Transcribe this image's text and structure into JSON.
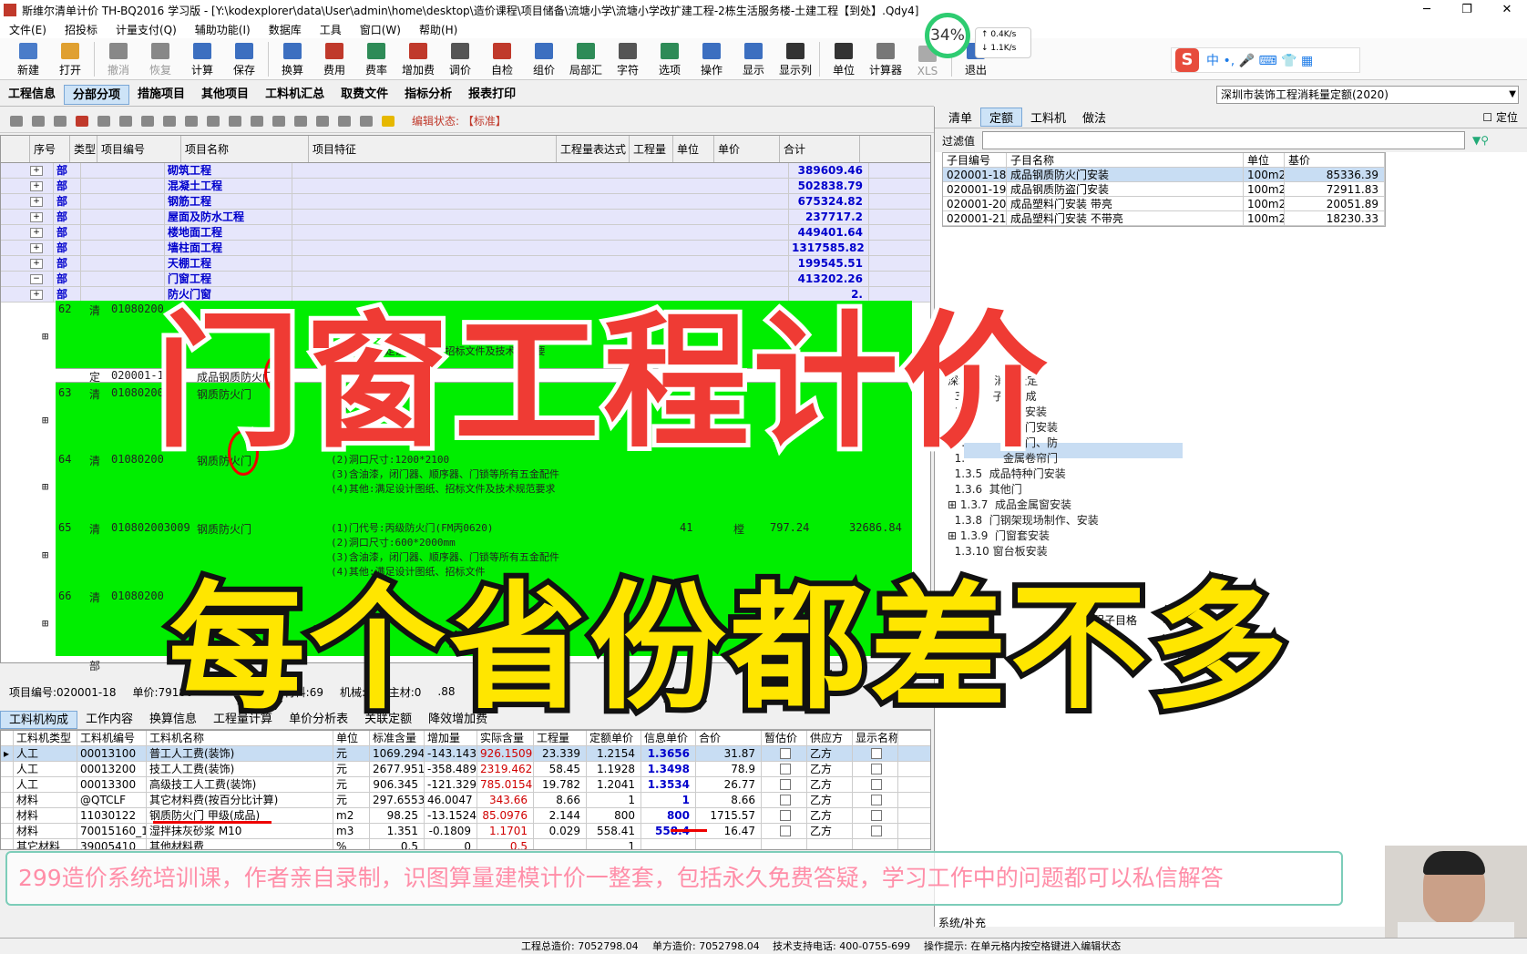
{
  "window": {
    "title": "斯维尔清单计价 TH-BQ2016 学习版 - [Y:\\kodexplorer\\data\\User\\admin\\home\\desktop\\造价课程\\项目储备\\流塘小学\\流塘小学改扩建工程-2栋生活服务楼-土建工程【到处】.Qdy4]",
    "minimize": "─",
    "maximize": "❐",
    "close": "✕"
  },
  "menu": [
    "文件(E)",
    "招投标",
    "计量支付(Q)",
    "辅助功能(I)",
    "数据库",
    "工具",
    "窗口(W)",
    "帮助(H)"
  ],
  "toolbar": [
    "新建",
    "打开",
    "撤消",
    "恢复",
    "计算",
    "保存",
    "换算",
    "费用",
    "费率",
    "增加费",
    "调价",
    "自检",
    "组价",
    "局部汇",
    "字符",
    "选项",
    "操作",
    "显示",
    "显示列",
    "单位",
    "计算器",
    "XLS",
    "退出"
  ],
  "gauge": {
    "percent": "34%",
    "up": "0.4K/s",
    "down": "1.1K/s"
  },
  "ime": {
    "logo": "S",
    "label": "中 •, 🎤 ⌨ 👕 ▦"
  },
  "navtabs": [
    "工程信息",
    "分部分项",
    "措施项目",
    "其他项目",
    "工料机汇总",
    "取费文件",
    "指标分析",
    "报表打印"
  ],
  "quota_select": "深圳市装饰工程消耗量定额(2020)",
  "edit_status": "编辑状态: 【标准】",
  "grid": {
    "columns": [
      "序号",
      "类型",
      "项目编号",
      "项目名称",
      "项目特征",
      "工程量表达式",
      "工程量",
      "单位",
      "单价",
      "合计"
    ],
    "sections": [
      {
        "type": "部",
        "name": "砌筑工程",
        "total": "389609.46"
      },
      {
        "type": "部",
        "name": "混凝土工程",
        "total": "502838.79"
      },
      {
        "type": "部",
        "name": "钢筋工程",
        "total": "675324.82"
      },
      {
        "type": "部",
        "name": "屋面及防水工程",
        "total": "237717.2"
      },
      {
        "type": "部",
        "name": "楼地面工程",
        "total": "449401.64"
      },
      {
        "type": "部",
        "name": "墙柱面工程",
        "total": "1317585.82"
      },
      {
        "type": "部",
        "name": "天棚工程",
        "total": "199545.51"
      },
      {
        "type": "部",
        "name": "门窗工程",
        "total": "413202.26"
      },
      {
        "type": "部",
        "name": "防火门窗",
        "total": "2."
      }
    ],
    "rows": [
      {
        "seq": "62",
        "type": "清",
        "code": "01080200",
        "spec": "(4)其他:满足设计图纸、招标文件及技术规范要"
      },
      {
        "seq": "",
        "type": "定",
        "code": "020001-18",
        "name": "成品钢质防火门安",
        "qty": "0.0"
      },
      {
        "seq": "63",
        "type": "清",
        "code": "01080200",
        "name": "钢质防火门",
        "spec": "(2)\n(3)\n(4)",
        "total": "5"
      },
      {
        "seq": "64",
        "type": "清",
        "code": "01080200",
        "name": "钢质防火门",
        "spec": "(2)洞口尺寸:1200*2100\n(3)含油漆，闭门器、顺序器、门锁等所有五金配件\n(4)其他:满足设计图纸、招标文件及技术规范要求"
      },
      {
        "seq": "65",
        "type": "清",
        "code": "010802003009",
        "name": "钢质防火门",
        "spec": "(1)门代号:丙级防火门(FM丙0620)\n(2)洞口尺寸:600*2000mm\n(3)含油漆，闭门器、顺序器、门锁等所有五金配件\n(4)其他:满足设计图纸、招标文件",
        "qty": "41",
        "unit": "樘",
        "price": "797.24",
        "total": "32686.84"
      },
      {
        "seq": "66",
        "type": "清",
        "code": "01080200"
      },
      {
        "seq": "",
        "type": "部"
      }
    ]
  },
  "right": {
    "tabs": [
      "清单",
      "定额",
      "工料机",
      "做法"
    ],
    "locate": "定位",
    "filter_label": "过滤值",
    "table_headers": [
      "子目编号",
      "子目名称",
      "单位",
      "基价"
    ],
    "table_rows": [
      [
        "020001-18",
        "成品钢质防火门安装",
        "100m2",
        "85336.39"
      ],
      [
        "020001-19",
        "成品钢质防盗门安装",
        "100m2",
        "72911.83"
      ],
      [
        "020001-20",
        "成品塑料门安装 带亮",
        "100m2",
        "20051.89"
      ],
      [
        "020001-21",
        "成品塑料门安装 不带亮",
        "100m2",
        "18230.33"
      ]
    ],
    "tree": [
      "深圳市    消耗量定",
      "  3         子目构成",
      "  1.           木门安装",
      "  1.           金属门安装",
      "  1.           防火门、防",
      "  1.           金属卷帘门",
      "  1.3.5  成品特种门安装",
      "  1.3.6  其他门",
      "⊞ 1.3.7  成品金属窗安装",
      "  1.3.8  门钢架现场制作、安装",
      "⊞ 1.3.9  门窗套安装",
      "  1.3.10 窗台板安装"
    ],
    "extra": "程子目格"
  },
  "info": {
    "code": "项目编号:020001-18",
    "price": "单价:79186",
    "material": "材料:69",
    "machine": "机械:0",
    "main": "主材:0",
    "other": ".88"
  },
  "btabs": [
    "工料机构成",
    "工作内容",
    "换算信息",
    "工程量计算",
    "单价分析表",
    "关联定额",
    "降效增加费"
  ],
  "btable": {
    "headers": [
      "工料机类型",
      "工料机编号",
      "工料机名称",
      "单位",
      "标准含量",
      "增加量",
      "实际含量",
      "工程量",
      "定额单价",
      "信息单价",
      "合价",
      "暂估价",
      "供应方",
      "显示名称"
    ],
    "rows": [
      [
        "人工",
        "00013100",
        "普工人工费(装饰)",
        "元",
        "1069.294",
        "-143.1431",
        "926.1509",
        "23.339",
        "1.2154",
        "1.3656",
        "31.87",
        "",
        "乙方",
        ""
      ],
      [
        "人工",
        "00013200",
        "技工人工费(装饰)",
        "元",
        "2677.951",
        "-358.489",
        "2319.462",
        "58.45",
        "1.1928",
        "1.3498",
        "78.9",
        "",
        "乙方",
        ""
      ],
      [
        "人工",
        "00013300",
        "高级技工人工费(装饰)",
        "元",
        "906.345",
        "-121.3296",
        "785.0154",
        "19.782",
        "1.2041",
        "1.3534",
        "26.77",
        "",
        "乙方",
        ""
      ],
      [
        "材料",
        "@QTCLF",
        "其它材料费(按百分比计算)",
        "元",
        "297.6553",
        "46.0047",
        "343.66",
        "8.66",
        "1",
        "1",
        "8.66",
        "",
        "乙方",
        ""
      ],
      [
        "材料",
        "11030122",
        "钢质防火门 甲级(成品)",
        "m2",
        "98.25",
        "-13.1524",
        "85.0976",
        "2.144",
        "800",
        "800",
        "1715.57",
        "",
        "乙方",
        ""
      ],
      [
        "材料",
        "70015160_1",
        "湿拌抹灰砂浆 M10",
        "m3",
        "1.351",
        "-0.1809",
        "1.1701",
        "0.029",
        "558.41",
        "558.4",
        "16.47",
        "",
        "乙方",
        ""
      ],
      [
        "其它材料",
        "39005410",
        "其他材料费",
        "%",
        "0.5",
        "0",
        "0.5",
        "",
        "1",
        "",
        "",
        "",
        "",
        ""
      ]
    ]
  },
  "banner": "299造价系统培训课，作者亲自录制，识图算量建模计价一整套，包括永久免费答疑，学习工作中的问题都可以私信解答",
  "overlay": {
    "line1": "门窗工程计价",
    "line2": "每个省份都差不多"
  },
  "status": {
    "total": "工程总造价: 7052798.04",
    "unit": "单方造价: 7052798.04",
    "phone": "技术支持电话: 400-0755-699",
    "tip": "操作提示: 在单元格内按空格键进入编辑状态"
  },
  "side_tabs": "系统/补充"
}
